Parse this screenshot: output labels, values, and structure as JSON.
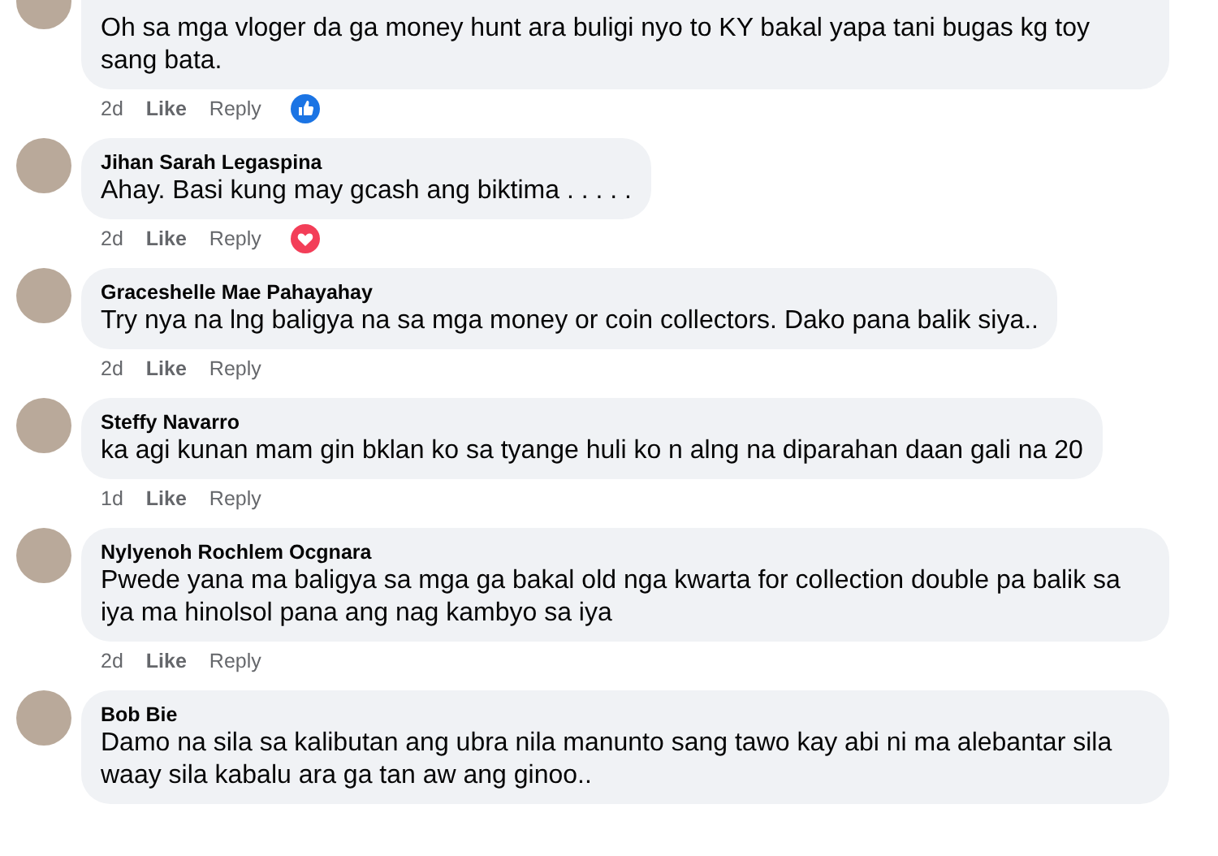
{
  "comments": [
    {
      "text": "Oh sa mga vloger da ga money hunt ara buligi nyo to KY bakal yapa tani bugas kg toy sang bata.",
      "time": "2d",
      "actions": [
        "Like",
        "Reply"
      ],
      "reaction": {
        "kind": "like"
      }
    },
    {
      "author": "Jihan Sarah Legaspina",
      "text": "Ahay. Basi kung may gcash ang biktima . . . . .",
      "time": "2d",
      "actions": [
        "Like",
        "Reply"
      ],
      "reaction": {
        "kind": "love"
      }
    },
    {
      "author": "Graceshelle Mae Pahayahay",
      "text": "Try nya na lng baligya na sa mga money or coin collectors. Dako pana balik siya..",
      "time": "2d",
      "actions": [
        "Like",
        "Reply"
      ]
    },
    {
      "author": "Steffy Navarro",
      "text": "ka agi kunan mam gin bklan ko sa tyange huli ko n alng na diparahan daan gali na 20",
      "time": "1d",
      "actions": [
        "Like",
        "Reply"
      ]
    },
    {
      "author": "Nylyenoh Rochlem Ocgnara",
      "text": "Pwede yana ma baligya sa mga ga bakal old nga kwarta for collection double pa balik sa iya ma hinolsol pana ang nag kambyo sa iya",
      "time": "2d",
      "actions": [
        "Like",
        "Reply"
      ]
    },
    {
      "author": "Bob Bie",
      "text": "Damo na sila sa kalibutan ang ubra nila manunto sang tawo kay abi ni ma alebantar sila waay sila kabalu ara ga tan aw ang ginoo.."
    }
  ]
}
